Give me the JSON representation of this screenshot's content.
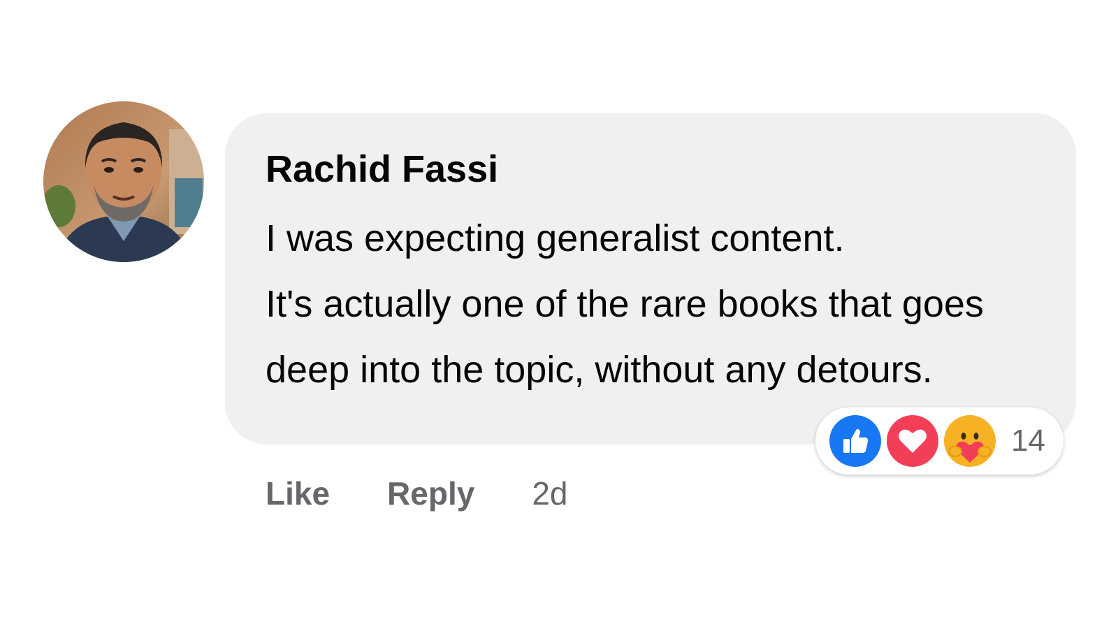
{
  "comment": {
    "author": "Rachid Fassi",
    "text_lines": [
      "I was expecting generalist content.",
      "It's actually one of the rare books that goes",
      "deep into the topic, without any detours."
    ],
    "avatar_icon": "profile-photo",
    "reactions": {
      "icons": [
        "like-icon",
        "love-icon",
        "care-icon"
      ],
      "count": "14",
      "colors": {
        "like": "#1877f2",
        "love": "#f33e58",
        "care": "#f7b125"
      }
    },
    "actions": {
      "like_label": "Like",
      "reply_label": "Reply",
      "timestamp": "2d"
    }
  },
  "colors": {
    "bubble": "#f0f0f2",
    "text": "#050505",
    "secondary_text": "#65676b"
  }
}
